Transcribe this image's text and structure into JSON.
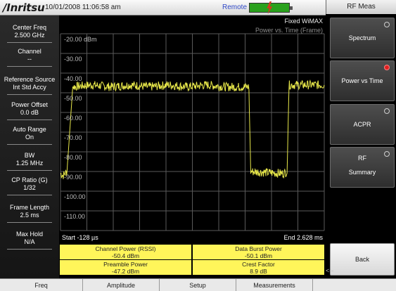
{
  "topbar": {
    "brand": "/Inritsu",
    "timestamp": "10/01/2008 11:06:58 am",
    "remote": "Remote"
  },
  "left_params": [
    {
      "label": "Center Freq",
      "value": "2.500 GHz"
    },
    {
      "label": "Channel",
      "value": "--"
    },
    {
      "label": "Reference Source",
      "value": "Int Std Accy"
    },
    {
      "label": "Power Offset",
      "value": "0.0 dB"
    },
    {
      "label": "Auto Range",
      "value": "On"
    },
    {
      "label": "BW",
      "value": "1.25 MHz"
    },
    {
      "label": "CP Ratio (G)",
      "value": "1/32"
    },
    {
      "label": "Frame Length",
      "value": "2.5 ms"
    },
    {
      "label": "Max Hold",
      "value": "N/A"
    }
  ],
  "display": {
    "title_line1": "Fixed WiMAX",
    "title_line2": "Power vs. Time (Frame)",
    "y_ticks": [
      "-20.00 dBm",
      "-30.00",
      "-40.00",
      "-50.00",
      "-60.00",
      "-70.00",
      "-80.00",
      "-90.00",
      "-100.00",
      "-110.00"
    ],
    "start_label": "Start -128 µs",
    "end_label": "End 2.628 ms"
  },
  "chart_data": {
    "type": "line",
    "xlabel": "",
    "ylabel": "",
    "x_unit": "ms",
    "y_unit": "dBm",
    "xlim": [
      -0.128,
      2.628
    ],
    "ylim": [
      -120,
      -20
    ],
    "grid": true,
    "series": [
      {
        "color": "#e8e84a",
        "x": [
          -0.128,
          -0.1,
          -0.06,
          0.0,
          0.2,
          0.4,
          0.6,
          0.8,
          1.0,
          1.2,
          1.4,
          1.6,
          1.84,
          1.86,
          2.2,
          2.24,
          2.26,
          2.628
        ],
        "y": [
          -91,
          -92,
          -90,
          -47,
          -46,
          -47,
          -46,
          -47,
          -46,
          -47,
          -46,
          -47,
          -47,
          -90,
          -91,
          -90,
          -46,
          -46
        ]
      }
    ]
  },
  "measurements": [
    {
      "label": "Channel Power (RSSI)",
      "value": "-50.4 dBm"
    },
    {
      "label": "Data Burst Power",
      "value": "-50.1 dBm"
    },
    {
      "label": "Preamble Power",
      "value": "-47.2 dBm"
    },
    {
      "label": "Crest Factor",
      "value": "8.9 dB"
    }
  ],
  "right_panel": {
    "header": "RF Meas",
    "spectrum": "Spectrum",
    "power_vs_time": "Power vs Time",
    "acpr": "ACPR",
    "rf_line1": "RF",
    "rf_line2": "Summary",
    "back": "Back",
    "dashes": "<--",
    "selected": "power_vs_time"
  },
  "bottom_keys": [
    "Freq",
    "Amplitude",
    "Setup",
    "Measurements"
  ],
  "colors": {
    "trace": "#e8e84a",
    "meas_bg": "#fff55a",
    "battery": "#2aa11d",
    "selected_radio": "#e02020"
  }
}
